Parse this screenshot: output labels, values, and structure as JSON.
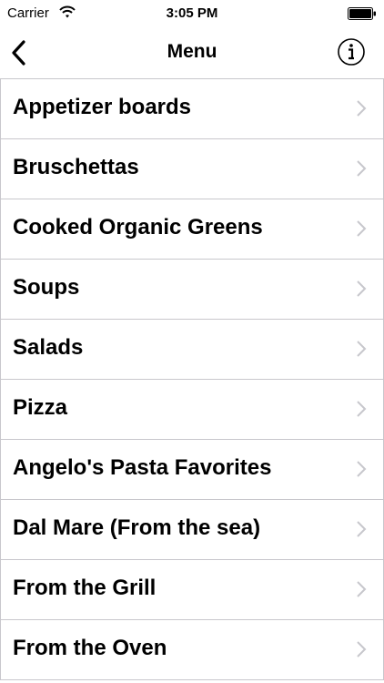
{
  "status": {
    "carrier": "Carrier",
    "time": "3:05 PM"
  },
  "nav": {
    "title": "Menu",
    "back_icon": "chevron-left-icon",
    "info_icon": "info-icon"
  },
  "menu": [
    {
      "label": "Appetizer boards"
    },
    {
      "label": "Bruschettas"
    },
    {
      "label": "Cooked Organic Greens"
    },
    {
      "label": "Soups"
    },
    {
      "label": "Salads"
    },
    {
      "label": "Pizza"
    },
    {
      "label": "Angelo's Pasta Favorites"
    },
    {
      "label": "Dal Mare (From the sea)"
    },
    {
      "label": "From the Grill"
    },
    {
      "label": "From the Oven"
    }
  ],
  "colors": {
    "separator": "#c8c7cc",
    "chevron": "#c7c7cc",
    "text": "#000000"
  }
}
